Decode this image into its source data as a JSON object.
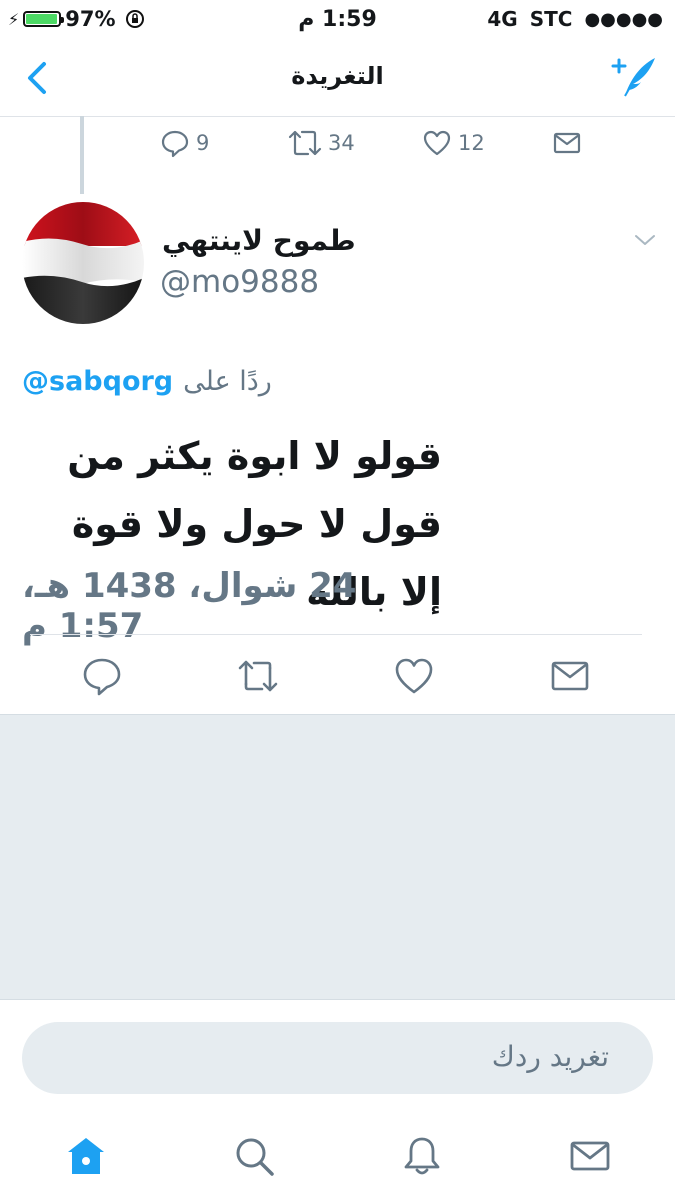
{
  "status": {
    "battery_pct": "97%",
    "time": "1:59 م",
    "network": "4G",
    "carrier": "STC",
    "signal": "●●●●●"
  },
  "nav": {
    "title": "التغريدة"
  },
  "prev_tweet_actions": {
    "replies": "9",
    "retweets": "34",
    "likes": "12"
  },
  "tweet": {
    "display_name": "طموح لاينتهي",
    "handle": "@mo9888",
    "reply_prefix": "ردًا على",
    "reply_to": "@sabqorg",
    "text_line1": "قولو لا ابوة يكثر من",
    "text_line2": "قول لا حول ولا قوة إلا بالله",
    "timestamp": "24 شوال، 1438 هـ، 1:57 م"
  },
  "reply_box": {
    "placeholder": "تغريد ردك"
  },
  "colors": {
    "accent": "#1da1f2",
    "secondary_text": "#657786",
    "divider": "#dfe3e8",
    "background_gray": "#e6ecf0"
  },
  "icons": {
    "back": "chevron-left-icon",
    "compose": "compose-feather-icon",
    "reply": "reply-icon",
    "retweet": "retweet-icon",
    "like": "heart-icon",
    "dm": "envelope-icon",
    "caret": "chevron-down-icon",
    "home": "home-icon",
    "search": "search-icon",
    "notifications": "bell-icon",
    "messages": "envelope-icon"
  }
}
